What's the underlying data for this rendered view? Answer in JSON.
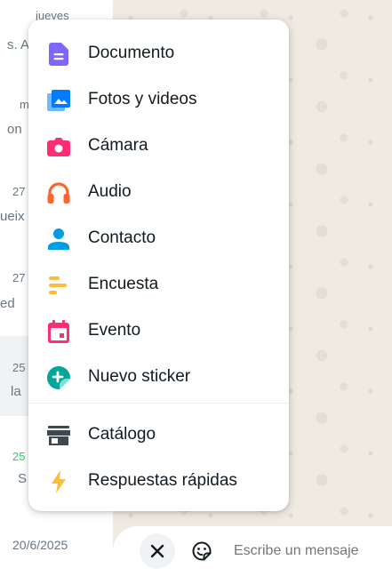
{
  "chat_list": {
    "rows": [
      {
        "time": "jueves",
        "snippet": "s. A"
      },
      {
        "time": "",
        "snippet": "m"
      },
      {
        "time": "",
        "snippet": "on"
      },
      {
        "time": "27",
        "snippet": "ueix"
      },
      {
        "time": "27",
        "snippet": "ed"
      },
      {
        "time": "25",
        "snippet": "la"
      },
      {
        "time": "25",
        "snippet": "S"
      },
      {
        "time": "20/6/2025",
        "snippet": ""
      }
    ],
    "accent_green": "#25d366"
  },
  "attach_menu": {
    "items": [
      {
        "label": "Documento",
        "icon": "document-icon",
        "color": "#7f66ff"
      },
      {
        "label": "Fotos y videos",
        "icon": "image-icon",
        "color": "#007bfc"
      },
      {
        "label": "Cámara",
        "icon": "camera-icon",
        "color": "#ff2e74"
      },
      {
        "label": "Audio",
        "icon": "headphones-icon",
        "color": "#fa6533"
      },
      {
        "label": "Contacto",
        "icon": "person-icon",
        "color": "#009de2"
      },
      {
        "label": "Encuesta",
        "icon": "poll-icon",
        "color": "#ffbc38"
      },
      {
        "label": "Evento",
        "icon": "calendar-icon",
        "color": "#ff2e74"
      },
      {
        "label": "Nuevo sticker",
        "icon": "new-sticker-icon",
        "color": "#02a698"
      },
      {
        "label": "Catálogo",
        "icon": "storefront-icon",
        "color": "#3b4a54"
      },
      {
        "label": "Respuestas rápidas",
        "icon": "lightning-icon",
        "color": "#ffbc38"
      }
    ]
  },
  "composer": {
    "placeholder": "Escribe un mensaje",
    "close_icon": "close-icon",
    "sticker_icon": "sticker-icon"
  }
}
